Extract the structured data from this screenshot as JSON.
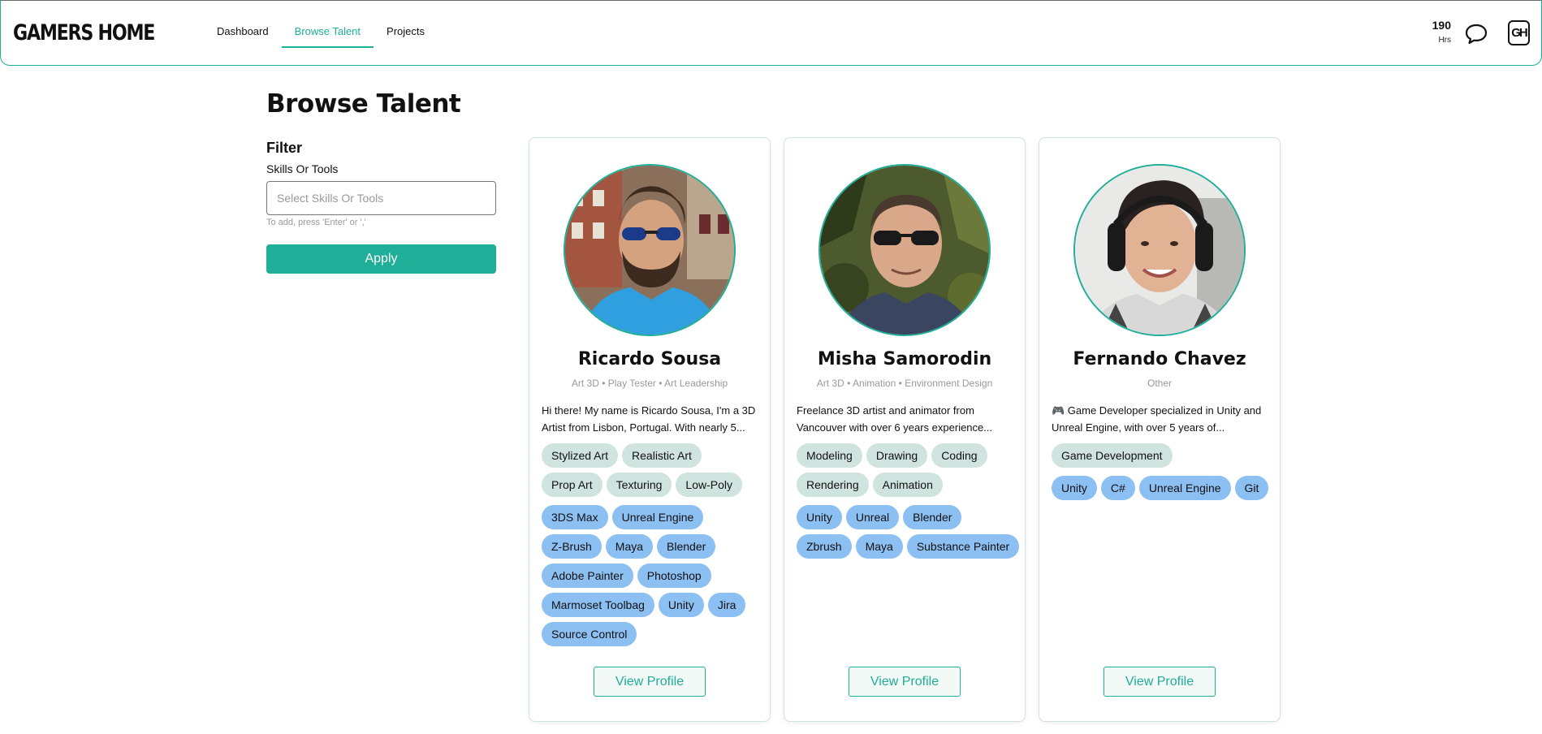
{
  "header": {
    "logo": "GAMERS HOME",
    "nav": [
      "Dashboard",
      "Browse Talent",
      "Projects"
    ],
    "hours_value": "190",
    "hours_label": "Hrs",
    "avatar_initials": "GH",
    "accent_color": "#1fae97"
  },
  "page": {
    "title": "Browse Talent"
  },
  "filter": {
    "title": "Filter",
    "label": "Skills Or Tools",
    "placeholder": "Select Skills Or Tools",
    "hint": "To add, press 'Enter' or ','",
    "apply_label": "Apply"
  },
  "cards": [
    {
      "name": "Ricardo Sousa",
      "roles": "Art 3D  •  Play Tester  •  Art Leadership",
      "bio_line1": "Hi there! My name is Ricardo Sousa, I'm a 3D",
      "bio_line2": "Artist from Lisbon, Portugal. With nearly 5...",
      "skills": [
        "Stylized Art",
        "Realistic Art",
        "Prop Art",
        "Texturing",
        "Low-Poly"
      ],
      "tools": [
        "3DS Max",
        "Unreal Engine",
        "Z-Brush",
        "Maya",
        "Blender",
        "Adobe Painter",
        "Photoshop",
        "Marmoset Toolbag",
        "Unity",
        "Jira",
        "Source Control"
      ],
      "button": "View Profile"
    },
    {
      "name": "Misha Samorodin",
      "roles": "Art 3D  •  Animation  •  Environment Design",
      "bio_line1": "Freelance 3D artist and animator from",
      "bio_line2": "Vancouver with over 6 years experience...",
      "skills": [
        "Modeling",
        "Drawing",
        "Coding",
        "Rendering",
        "Animation"
      ],
      "tools": [
        "Unity",
        "Unreal",
        "Blender",
        "Zbrush",
        "Maya",
        "Substance Painter"
      ],
      "button": "View Profile"
    },
    {
      "name": "Fernando Chavez",
      "roles": "Other",
      "bio_line1": "🎮 Game Developer specialized in Unity and",
      "bio_line2": "Unreal Engine, with over 5 years of...",
      "skills": [
        "Game Development"
      ],
      "tools": [
        "Unity",
        "C#",
        "Unreal Engine",
        "Git"
      ],
      "button": "View Profile"
    }
  ]
}
